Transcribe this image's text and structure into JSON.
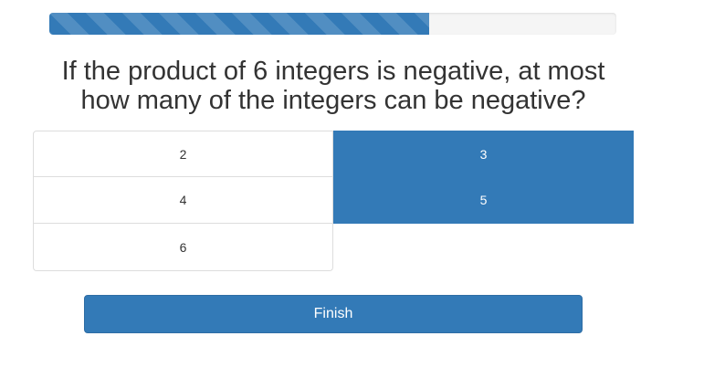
{
  "progress": {
    "percent": 67
  },
  "question": {
    "line1": "If the product of 6 integers is negative, at most",
    "line2": "how many of the integers can be negative?"
  },
  "options": [
    {
      "label": "2",
      "selected": false
    },
    {
      "label": "3",
      "selected": true
    },
    {
      "label": "4",
      "selected": false
    },
    {
      "label": "5",
      "selected": true
    },
    {
      "label": "6",
      "selected": false
    }
  ],
  "finish_label": "Finish",
  "colors": {
    "accent": "#337ab7",
    "text": "#333333",
    "border": "#dddddd",
    "track": "#f5f5f5"
  }
}
